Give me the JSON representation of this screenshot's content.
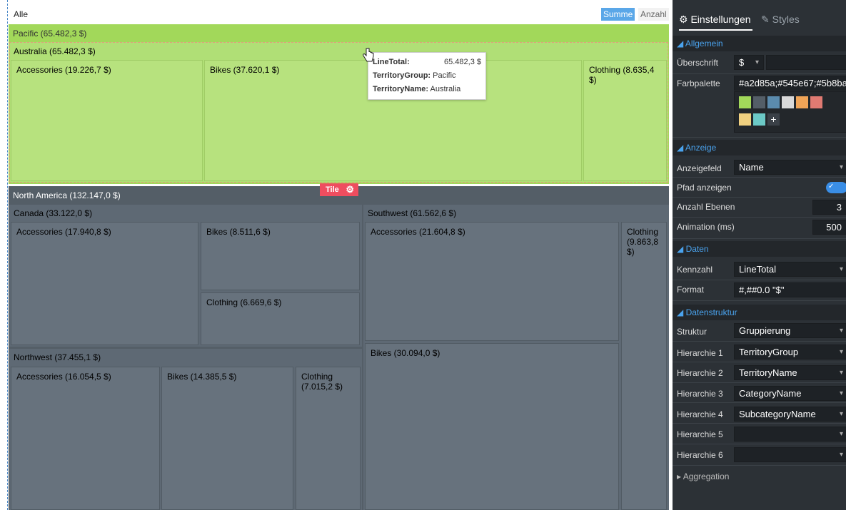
{
  "breadcrumb": "Alle",
  "aggregation": {
    "sum_label": "Summe",
    "count_label": "Anzahl"
  },
  "treemap": {
    "pacific": "Pacific (65.482,3 $)",
    "australia": "Australia (65.482,3 $)",
    "au_accessories": "Accessories (19.226,7 $)",
    "au_bikes": "Bikes (37.620,1 $)",
    "au_clothing": "Clothing (8.635,4 $)",
    "north_america": "North America (132.147,0 $)",
    "canada": "Canada (33.122,0 $)",
    "ca_accessories": "Accessories (17.940,8 $)",
    "ca_bikes": "Bikes (8.511,6 $)",
    "ca_clothing": "Clothing (6.669,6 $)",
    "northwest": "Northwest (37.455,1 $)",
    "nw_accessories": "Accessories (16.054,5 $)",
    "nw_bikes": "Bikes (14.385,5 $)",
    "nw_clothing": "Clothing (7.015,2 $)",
    "southwest": "Southwest (61.562,6 $)",
    "sw_accessories": "Accessories (21.604,8 $)",
    "sw_bikes": "Bikes (30.094,0 $)",
    "sw_clothing": "Clothing (9.863,8 $)"
  },
  "tile_badge": "Tile",
  "tooltip": {
    "rows": [
      {
        "key": "LineTotal:",
        "value": "65.482,3 $"
      },
      {
        "key": "TerritoryGroup:",
        "value": "Pacific"
      },
      {
        "key": "TerritoryName:",
        "value": "Australia"
      }
    ]
  },
  "panel": {
    "tab_settings": "Einstellungen",
    "tab_styles": "Styles",
    "sections": {
      "allgemein": "Allgemein",
      "anzeige": "Anzeige",
      "daten": "Daten",
      "datenstruktur": "Datenstruktur",
      "aggregation": "Aggregation"
    },
    "ueberschrift_label": "Überschrift",
    "ueberschrift_value": "$",
    "farbpalette_label": "Farbpalette",
    "farbpalette_value": "#a2d85a;#545e67;#5b8ba",
    "palette_colors": [
      "#a2d85a",
      "#545e67",
      "#5b8bad",
      "#d9d9d9",
      "#f0a457",
      "#e07a72",
      "#f0d080",
      "#6cc9c6"
    ],
    "anzeigefeld_label": "Anzeigefeld",
    "anzeigefeld_value": "Name",
    "pfad_label": "Pfad anzeigen",
    "ebenen_label": "Anzahl Ebenen",
    "ebenen_value": "3",
    "animation_label": "Animation (ms)",
    "animation_value": "500",
    "kennzahl_label": "Kennzahl",
    "kennzahl_value": "LineTotal",
    "format_label": "Format",
    "format_value": "#,##0.0 \"$\"",
    "struktur_label": "Struktur",
    "struktur_value": "Gruppierung",
    "hierarchie": [
      {
        "label": "Hierarchie 1",
        "value": "TerritoryGroup"
      },
      {
        "label": "Hierarchie 2",
        "value": "TerritoryName"
      },
      {
        "label": "Hierarchie 3",
        "value": "CategoryName"
      },
      {
        "label": "Hierarchie 4",
        "value": "SubcategoryName"
      },
      {
        "label": "Hierarchie 5",
        "value": ""
      },
      {
        "label": "Hierarchie 6",
        "value": ""
      }
    ]
  }
}
